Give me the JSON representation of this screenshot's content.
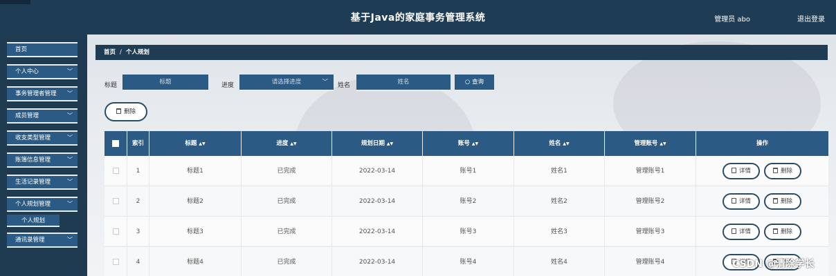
{
  "header": {
    "title": "基于Java的家庭事务管理系统",
    "user": "管理员 abo",
    "logout": "退出登录"
  },
  "sidebar": {
    "items": [
      {
        "label": "首页",
        "has_chevron": false
      },
      {
        "label": "个人中心",
        "has_chevron": true
      },
      {
        "label": "事务管理者管理",
        "has_chevron": true
      },
      {
        "label": "成员管理",
        "has_chevron": true
      },
      {
        "label": "收支类型管理",
        "has_chevron": true
      },
      {
        "label": "账簿信息管理",
        "has_chevron": true
      },
      {
        "label": "生活记录管理",
        "has_chevron": true
      },
      {
        "label": "个人规划管理",
        "has_chevron": true
      },
      {
        "label": "通讯录管理",
        "has_chevron": true
      }
    ],
    "sub_item": "个人规划",
    "chevron": "chevron-down-icon"
  },
  "breadcrumb": {
    "home": "首页",
    "separator": "/",
    "current": "个人规划"
  },
  "search": {
    "title_label": "标题",
    "title_placeholder": "标题",
    "progress_label": "进度",
    "progress_placeholder": "请选择进度",
    "name_label": "姓名",
    "name_placeholder": "姓名",
    "search_button": "查询"
  },
  "toolbar": {
    "delete_button": "删除"
  },
  "table": {
    "headers": [
      "索引",
      "标题",
      "进度",
      "规划日期",
      "账号",
      "姓名",
      "管理账号",
      "操作"
    ],
    "rows": [
      {
        "index": "1",
        "title": "标题1",
        "progress": "已完成",
        "date": "2022-03-14",
        "account": "账号1",
        "name": "姓名1",
        "admin": "管理账号1"
      },
      {
        "index": "2",
        "title": "标题2",
        "progress": "已完成",
        "date": "2022-03-14",
        "account": "账号2",
        "name": "姓名2",
        "admin": "管理账号2"
      },
      {
        "index": "3",
        "title": "标题3",
        "progress": "已完成",
        "date": "2022-03-14",
        "account": "账号3",
        "name": "姓名3",
        "admin": "管理账号3"
      },
      {
        "index": "4",
        "title": "标题4",
        "progress": "已完成",
        "date": "2022-03-14",
        "account": "账号4",
        "name": "姓名4",
        "admin": "管理账号4"
      }
    ],
    "detail_button": "详情",
    "delete_button": "删除"
  },
  "watermark": "CSDN @清除学长",
  "colors": {
    "header_bg": "#1e3d55",
    "sidebar_item": "#2b5b84",
    "table_header": "#2b5b84"
  }
}
